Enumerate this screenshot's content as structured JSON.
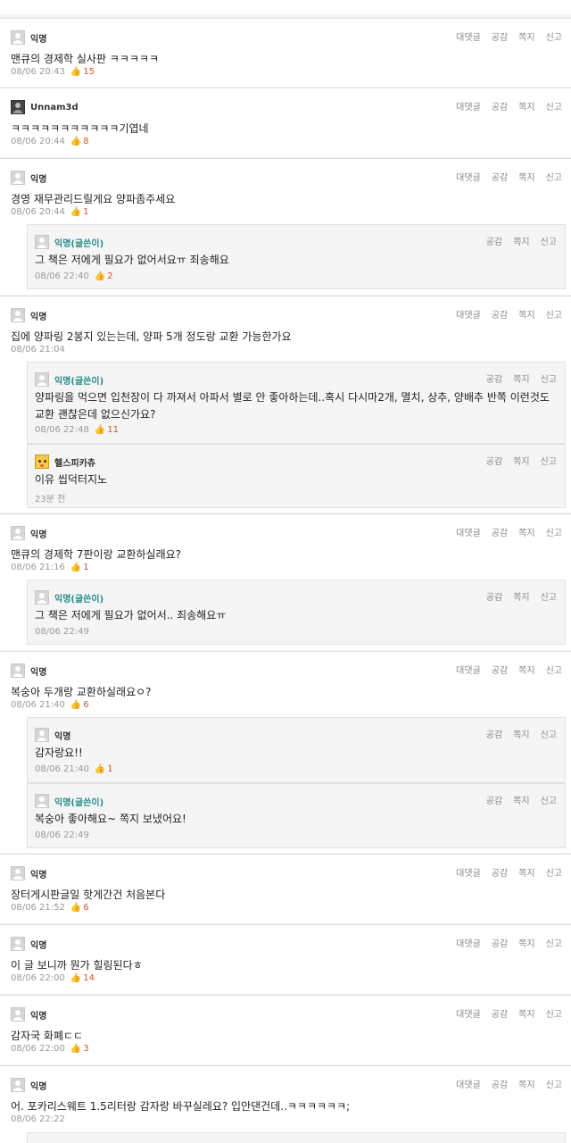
{
  "labels": {
    "reply": "대댓글",
    "like": "공감",
    "message": "쪽지",
    "report": "신고"
  },
  "comments": [
    {
      "author": "익명",
      "text": "맨큐의 경제학 실사판 ㅋㅋㅋㅋㅋ",
      "time": "08/06 20:43",
      "likes": "15"
    },
    {
      "author": "Unnam3d",
      "text": "ㅋㅋㅋㅋㅋㅋㅋㅋㅋㅋㅋ기엽네",
      "time": "08/06 20:44",
      "likes": "8"
    },
    {
      "author": "익명",
      "text": "경영 재무관리드릴게요 양파좀주세요",
      "time": "08/06 20:44",
      "likes": "1",
      "replies": [
        {
          "author": "익명(글쓴이)",
          "text": "그 책은 저에게 필요가 없어서요ㅠ 죄송해요",
          "time": "08/06 22:40",
          "likes": "2"
        }
      ]
    },
    {
      "author": "익명",
      "text": "집에 양파링 2봉지 있는는데, 양파 5개 정도랑 교환 가능한가요",
      "time": "08/06 21:04",
      "likes": "",
      "replies": [
        {
          "author": "익명(글쓴이)",
          "text": "양파링을 먹으면 입천장이 다 까져서 아파서 별로 안 좋아하는데..혹시 다시마2개, 멸치, 상추, 양배추 반쪽 이런것도 교환 괜찮은데 없으신가요?",
          "time": "08/06 22:48",
          "likes": "11"
        },
        {
          "author": "헬스피카츄",
          "text": "이유 씹덕터지노",
          "time": "23분 전",
          "likes": ""
        }
      ]
    },
    {
      "author": "익명",
      "text": "맨큐의 경제학 7판이랑 교환하실래요?",
      "time": "08/06 21:16",
      "likes": "1",
      "replies": [
        {
          "author": "익명(글쓴이)",
          "text": "그 책은 저에게 필요가 없어서.. 죄송해요ㅠ",
          "time": "08/06 22:49",
          "likes": ""
        }
      ]
    },
    {
      "author": "익명",
      "text": "복숭아 두개랑 교환하실래요ㅇ?",
      "time": "08/06 21:40",
      "likes": "6",
      "replies": [
        {
          "author": "익명",
          "text": "감자랑요!!",
          "time": "08/06 21:40",
          "likes": "1"
        },
        {
          "author": "익명(글쓴이)",
          "text": "복숭아 좋아해요~ 쪽지 보냈어요!",
          "time": "08/06 22:49",
          "likes": ""
        }
      ]
    },
    {
      "author": "익명",
      "text": "장터게시판글일 핫게간건 처음본다",
      "time": "08/06 21:52",
      "likes": "6"
    },
    {
      "author": "익명",
      "text": "이 글 보니까 뭔가 힐링된다ㅎ",
      "time": "08/06 22:00",
      "likes": "14"
    },
    {
      "author": "익명",
      "text": "감자국 화폐ㄷㄷ",
      "time": "08/06 22:00",
      "likes": "3"
    },
    {
      "author": "익명",
      "text": "어. 포카리스웨트 1.5리터랑 감자랑 바꾸실레요? 입안댄건데..ㅋㅋㅋㅋㅋㅋ;",
      "time": "08/06 22:22",
      "likes": ""
    }
  ]
}
